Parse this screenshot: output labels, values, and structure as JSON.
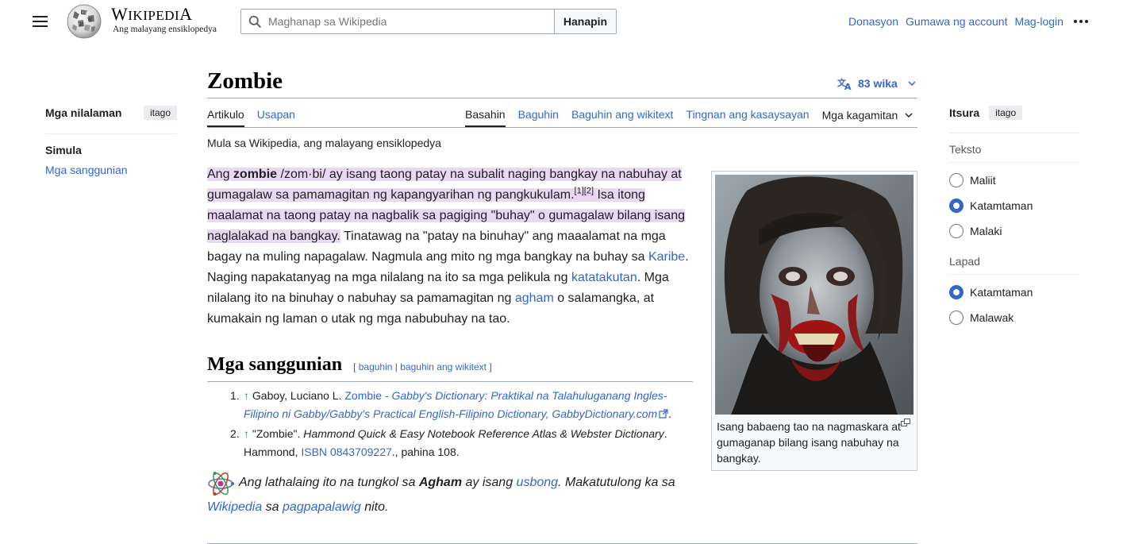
{
  "header": {
    "logo_word": [
      "W",
      "IKIPEDI",
      "A"
    ],
    "tagline": "Ang malayang ensiklopedya",
    "search_placeholder": "Maghanap sa Wikipedia",
    "search_button": "Hanapin",
    "user_links": [
      "Donasyon",
      "Gumawa ng account",
      "Mag-login"
    ]
  },
  "toc": {
    "title": "Mga nilalaman",
    "hide": "itago",
    "top": "Simula",
    "items": [
      "Mga sanggunian"
    ]
  },
  "article": {
    "title": "Zombie",
    "languages": "83 wika",
    "tabs_left": [
      "Artikulo",
      "Usapan"
    ],
    "tabs_right": [
      "Basahin",
      "Baguhin",
      "Baguhin ang wikitext",
      "Tingnan ang kasaysayan"
    ],
    "tools": "Mga kagamitan",
    "site_sub": "Mula sa Wikipedia, ang malayang ensiklopedya",
    "lead": {
      "p1": "Ang ",
      "bold": "zombie",
      "p2": " /zom·bi/ ay isang taong patay na subalit naging bangkay na nabuhay at gumagalaw sa pamamagitan ng kapangyarihan ng pangkukulam.",
      "sup1": "[1]",
      "sup2": "[2]",
      "p3": " Isa itong maalamat na taong patay na nagbalik sa pagiging \"buhay\" o gumagalaw bilang isang naglalakad na bangkay.",
      "p4": " Tinatawag na \"patay na binuhay\" ang maaalamat na mga bagay na muling napagalaw. Nagmula ang mito ng mga bangkay na buhay sa ",
      "link1": "Karibe",
      "p5": ". Naging napakatanyag na mga nilalang na ito sa mga pelikula ng ",
      "link2": "katatakutan",
      "p6": ". Mga nilalang ito na binuhay o nabuhay sa pamamagitan ng ",
      "link3": "agham",
      "p7": " o salamangka, at kumakain ng laman o utak ng mga nabubuhay na tao."
    },
    "infobox_caption": "Isang babaeng tao na nagmaskara at gumaganap bilang isang nabuhay na bangkay.",
    "section_title": "Mga sanggunian",
    "editsec": {
      "open": "[ ",
      "edit": "baguhin",
      "sep": " | ",
      "edit_source": "baguhin ang wikitext",
      "close": " ]"
    },
    "references": [
      {
        "num": "1.",
        "arrow": "↑",
        "author": " Gaboy, Luciano L. ",
        "link": "Zombie - ",
        "link_italic": "Gabby's Dictionary: Praktikal na Talahuluganang Ingles-Filipino ni Gabby/Gabby's Practical English-Filipino Dictionary",
        "link_tail": ", GabbyDictionary.com",
        "end": "."
      },
      {
        "num": "2.",
        "arrow": "↑",
        "text1": " \"Zombie\". ",
        "italic": "Hammond Quick & Easy Notebook Reference Atlas & Webster Dictionary",
        "text2": ". Hammond, ",
        "isbn": "ISBN 0843709227",
        "text3": "., pahina 108."
      }
    ],
    "stub": {
      "t1": "Ang lathalaing ito na tungkol sa ",
      "bold": "Agham",
      "t2": " ay isang ",
      "link1": "usbong",
      "t3": ". Makatutulong ka sa ",
      "link2": "Wikipedia",
      "t4": " sa ",
      "link3": "pagpapalawig",
      "t5": " nito."
    }
  },
  "appearance": {
    "title": "Itsura",
    "hide": "itago",
    "text_group": "Teksto",
    "text_options": [
      {
        "label": "Maliit",
        "checked": false
      },
      {
        "label": "Katamtaman",
        "checked": true
      },
      {
        "label": "Malaki",
        "checked": false
      }
    ],
    "width_group": "Lapad",
    "width_options": [
      {
        "label": "Katamtaman",
        "checked": true
      },
      {
        "label": "Malawak",
        "checked": false
      }
    ]
  },
  "colors": {
    "link": "#3366cc",
    "highlight": "#e9d8f4",
    "text": "#202122"
  }
}
